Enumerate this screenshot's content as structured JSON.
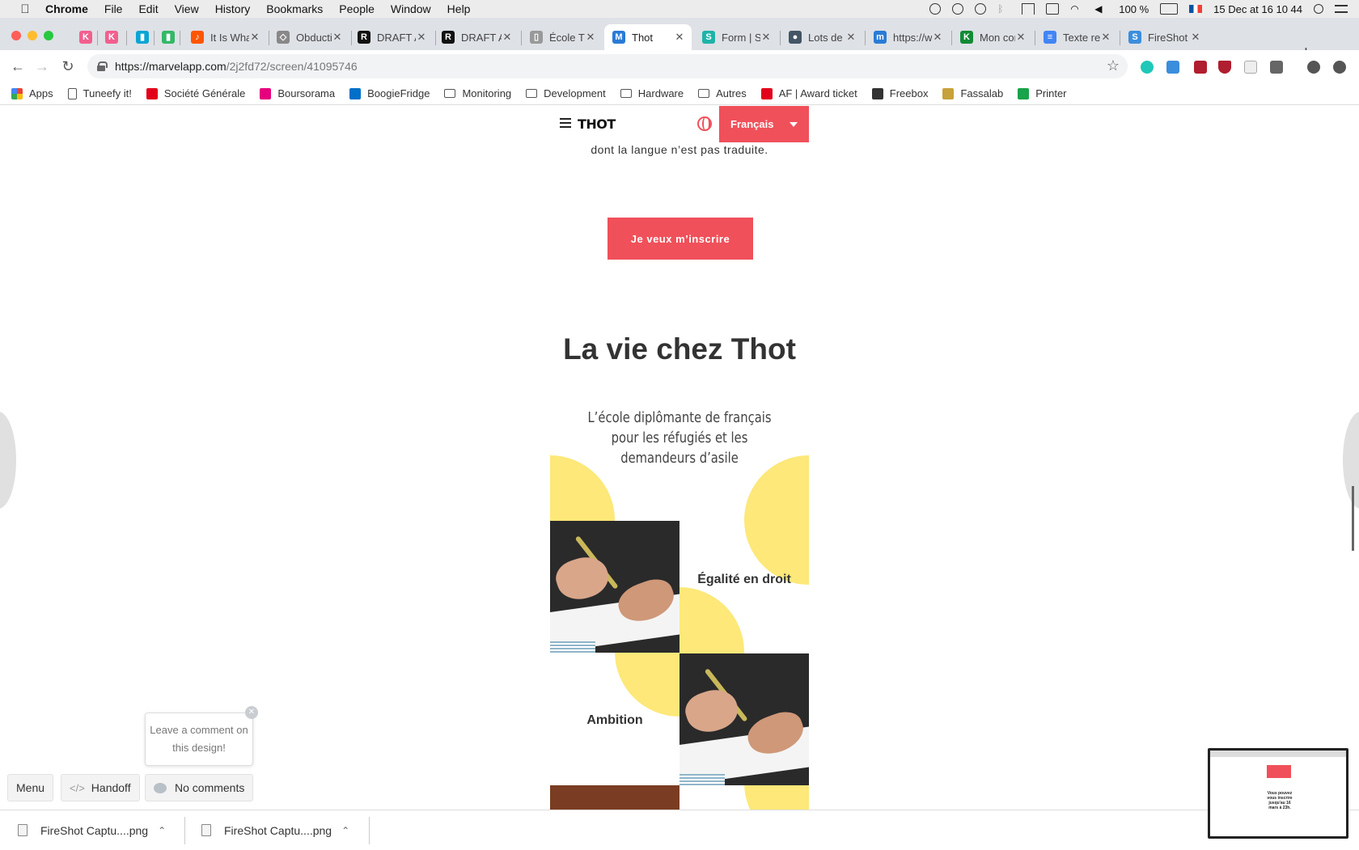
{
  "os_menubar": {
    "app": "Chrome",
    "items": [
      "File",
      "Edit",
      "View",
      "History",
      "Bookmarks",
      "People",
      "Window",
      "Help"
    ],
    "battery": "100 %",
    "datetime": "15 Dec at  16 10 44"
  },
  "tabs": [
    {
      "title": "",
      "favicon_color": "#f25f8f",
      "favicon_char": "K"
    },
    {
      "title": "",
      "favicon_color": "#f25f8f",
      "favicon_char": "K"
    },
    {
      "title": "",
      "favicon_color": "#0aa5d4",
      "favicon_char": "▮"
    },
    {
      "title": "",
      "favicon_color": "#34b867",
      "favicon_char": "▮"
    },
    {
      "title": "It Is Wha",
      "favicon_color": "#ff5500",
      "favicon_char": "♪"
    },
    {
      "title": "Obductic",
      "favicon_color": "#888888",
      "favicon_char": "◇"
    },
    {
      "title": "DRAFT A",
      "favicon_color": "#111111",
      "favicon_char": "R"
    },
    {
      "title": "DRAFT A",
      "favicon_color": "#111111",
      "favicon_char": "R"
    },
    {
      "title": "École Th",
      "favicon_color": "#999999",
      "favicon_char": "▯"
    },
    {
      "title": "Thot",
      "favicon_color": "#2a7bd6",
      "favicon_char": "M",
      "active": true
    },
    {
      "title": "Form | Sl",
      "favicon_color": "#1fb3a8",
      "favicon_char": "S"
    },
    {
      "title": "Lots de",
      "favicon_color": "#445566",
      "favicon_char": "●"
    },
    {
      "title": "https://w",
      "favicon_color": "#2a7bd6",
      "favicon_char": "m"
    },
    {
      "title": "Mon con",
      "favicon_color": "#138a36",
      "favicon_char": "K"
    },
    {
      "title": "Texte ref",
      "favicon_color": "#4285f4",
      "favicon_char": "≡"
    },
    {
      "title": "FireShot",
      "favicon_color": "#3b8edc",
      "favicon_char": "S"
    }
  ],
  "address_bar": {
    "host": "https://marvelapp.com",
    "path": "/2j2fd72/screen/41095746"
  },
  "bookmarks": [
    {
      "label": "Apps",
      "type": "apps"
    },
    {
      "label": "Tuneefy it!",
      "type": "page"
    },
    {
      "label": "Société Générale",
      "type": "brand",
      "color": "#e2001a"
    },
    {
      "label": "Boursorama",
      "type": "brand",
      "color": "#e6007e"
    },
    {
      "label": "BoogieFridge",
      "type": "brand",
      "color": "#0070c9"
    },
    {
      "label": "Monitoring",
      "type": "folder"
    },
    {
      "label": "Development",
      "type": "folder"
    },
    {
      "label": "Hardware",
      "type": "folder"
    },
    {
      "label": "Autres",
      "type": "folder"
    },
    {
      "label": "AF | Award ticket",
      "type": "brand",
      "color": "#e2001a"
    },
    {
      "label": "Freebox",
      "type": "brand",
      "color": "#333333"
    },
    {
      "label": "Fassalab",
      "type": "brand",
      "color": "#c7a23a"
    },
    {
      "label": "Printer",
      "type": "brand",
      "color": "#19a34a"
    }
  ],
  "design": {
    "logo": "THOT",
    "language": "Français",
    "intro_text": "personnes ne sachant ni lire ni écrire ou dont la langue n’est pas traduite.",
    "cta": "Je veux m’inscrire",
    "heading": "La vie chez Thot",
    "subheading": "L’école diplômante de français pour les réfugiés et les demandeurs d’asile",
    "values": [
      "Égalité en droit",
      "Ambition"
    ],
    "colors": {
      "accent": "#f0505a",
      "yellow": "#fde879"
    }
  },
  "marvel": {
    "tooltip": "Leave a comment on this design!",
    "menu": "Menu",
    "handoff": "Handoff",
    "comments": "No comments"
  },
  "downloads": [
    {
      "name": "FireShot Captu....png"
    },
    {
      "name": "FireShot Captu....png"
    }
  ],
  "preview_text": "Vous pouvez vous inscrire jusqu'au 16 mars à 23h."
}
